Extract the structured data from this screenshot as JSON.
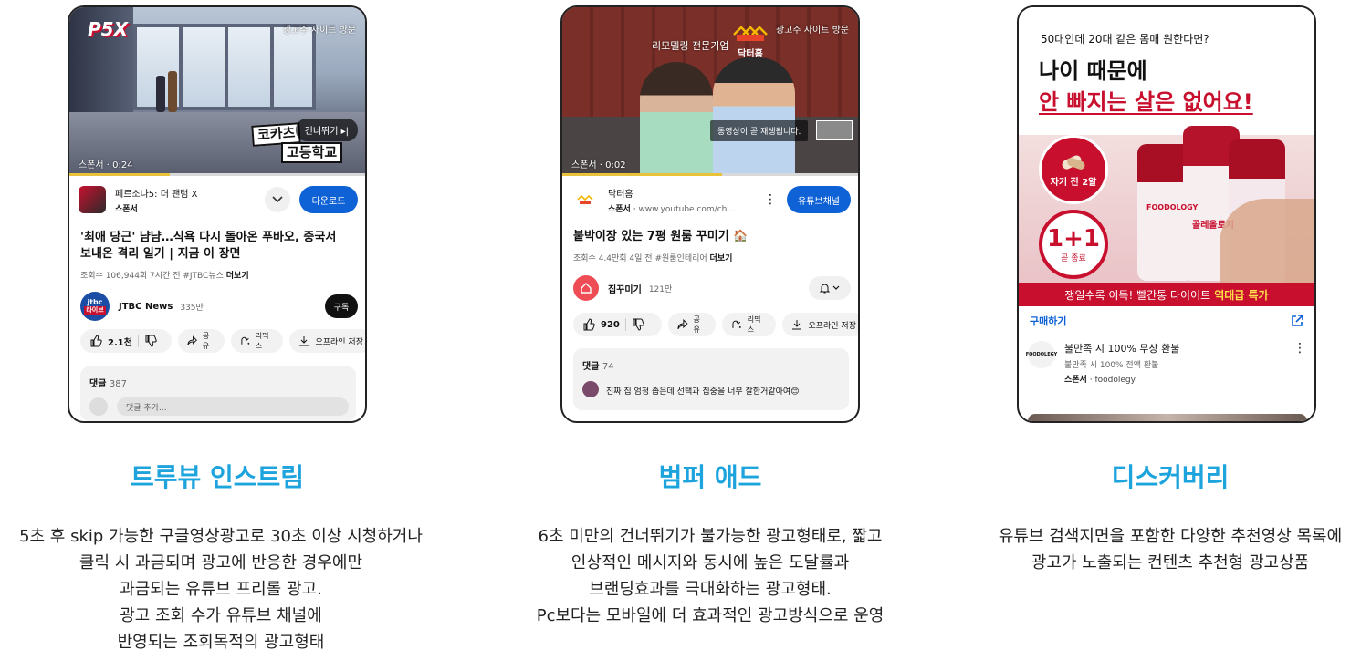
{
  "cards": [
    {
      "video": {
        "game_logo": "P5X",
        "ad_site_link": "광고주 사이트 방문",
        "skip_label": "건너뛰기 ▸|",
        "sponsor_time": "스폰서 · 0:24",
        "overlay_title_1": "코카츠",
        "overlay_title_2": "고등학교"
      },
      "ad": {
        "name": "페르소나5: 더 팬텀 X",
        "sponsor": "스폰서",
        "cta": "다운로드"
      },
      "title_line1": "'최애 당근' 냠냠…식욕 다시 돌아온 푸바오, 중국서",
      "title_line2": "보내온 격리 일기 | 지금 이 장면",
      "meta": "조회수 106,944회   7시간 전  #JTBC뉴스",
      "more": "더보기",
      "channel": {
        "logo": "jtbc",
        "logo_sub": "라이브",
        "name": "JTBC News",
        "subs": "335만",
        "subscribe": "구독"
      },
      "actions": {
        "likes": "2.1천",
        "share": "공유",
        "remix": "리믹스",
        "offline": "오프라인 저장"
      },
      "comments": {
        "label": "댓글",
        "count": "387",
        "placeholder": "댓글 추가..."
      }
    },
    {
      "video": {
        "brand_text": "리모델링 전문기업",
        "brand_name": "닥터홈",
        "ad_site_link": "광고주 사이트 방문",
        "notice": "동영상이 곧 재생됩니다.",
        "sponsor_time": "스폰서 · 0:02"
      },
      "ad": {
        "name": "닥터홈",
        "sponsor": "스폰서",
        "url": "www.youtube.com/ch...",
        "cta": "유튜브채널"
      },
      "title_line1": "붙박이장 있는 7평 원룸 꾸미기 🏠",
      "meta": "조회수 4.4만회   4일 전  #원룸인테리어",
      "more": "더보기",
      "channel": {
        "name": "집꾸미기",
        "subs": "121만"
      },
      "actions": {
        "likes": "920",
        "share": "공유",
        "remix": "리믹스",
        "offline": "오프라인 저장"
      },
      "comments": {
        "label": "댓글",
        "count": "74",
        "text": "진짜 집 엄청 좁은데 선택과 집중을 너무 잘한거같아여😊"
      }
    },
    {
      "banner": {
        "pre": "50대인데 20대 같은 몸매 원한다면?",
        "line1": "나이 때문에",
        "line2": "안 빠지는 살은 없어요!",
        "badge1": "자기 전 2알",
        "badge2_big": "1+1",
        "badge2_small": "곧 종료",
        "bottle_brand": "FOODOLOGY",
        "bottle_label": "콜레올로지",
        "strip_text": "쟁일수록 이득! 빨간통 다이어트",
        "strip_bold": "역대급 특가"
      },
      "buy_label": "구매하기",
      "ad": {
        "logo": "FOODOLEGY",
        "title": "불만족 시 100% 무상 환불",
        "sub": "불만족 시 100% 전액 환불",
        "sponsor": "스폰서",
        "domain": "foodolegy"
      }
    }
  ],
  "sections": [
    {
      "heading": "트루뷰 인스트림",
      "desc": "5초 후 skip 가능한 구글영상광고로 30초 이상 시청하거나\n클릭 시 과금되며 광고에 반응한 경우에만\n과금되는 유튜브 프리롤 광고.\n광고 조회 수가 유튜브 채널에\n반영되는 조회목적의 광고형태"
    },
    {
      "heading": "범퍼 애드",
      "desc": "6초 미만의 건너뛰기가 불가능한 광고형태로, 짧고\n인상적인 메시지와 동시에 높은 도달률과\n브랜딩효과를 극대화하는 광고형태.\nPc보다는 모바일에 더 효과적인 광고방식으로 운영"
    },
    {
      "heading": "디스커버리",
      "desc": "유튜브 검색지면을 포함한 다양한 추천영상 목록에\n광고가 노출되는 컨텐츠 추천형 광고상품"
    }
  ],
  "colors": {
    "heading": "#1ea4dd",
    "cta_blue": "#0f62d6",
    "progress": "#e8c23a",
    "strip_red": "#c8102e"
  }
}
